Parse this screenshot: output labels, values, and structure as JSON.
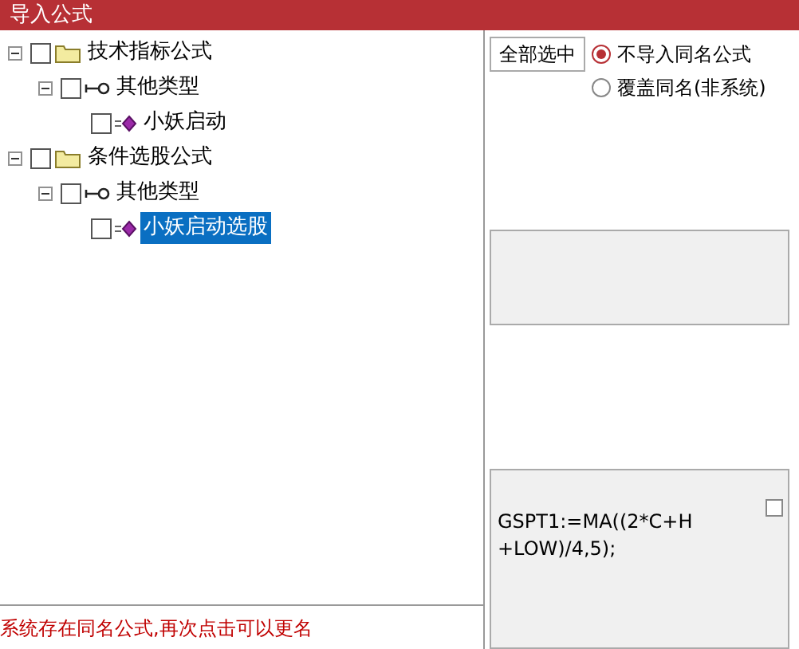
{
  "window": {
    "title": "导入公式"
  },
  "tree": [
    {
      "kind": "folder",
      "label": "技术指标公式",
      "checked": false,
      "expanded": true,
      "selected": false,
      "children": [
        {
          "kind": "type",
          "label": "其他类型",
          "checked": false,
          "expanded": true,
          "selected": false,
          "children": [
            {
              "kind": "formula",
              "label": "小妖启动",
              "checked": false,
              "selected": false
            }
          ]
        }
      ]
    },
    {
      "kind": "folder",
      "label": "条件选股公式",
      "checked": false,
      "expanded": true,
      "selected": false,
      "children": [
        {
          "kind": "type",
          "label": "其他类型",
          "checked": false,
          "expanded": true,
          "selected": false,
          "children": [
            {
              "kind": "formula",
              "label": "小妖启动选股",
              "checked": false,
              "selected": true
            }
          ]
        }
      ]
    }
  ],
  "select_all_button": "全部选中",
  "options": [
    {
      "label": "不导入同名公式",
      "selected": true
    },
    {
      "label": "覆盖同名(非系统)",
      "selected": false
    }
  ],
  "formula": {
    "text": "GSPT1:=MA((2*C+H\n+LOW)/4,5);",
    "checked": false
  },
  "status": "系统存在同名公式,再次点击可以更名"
}
